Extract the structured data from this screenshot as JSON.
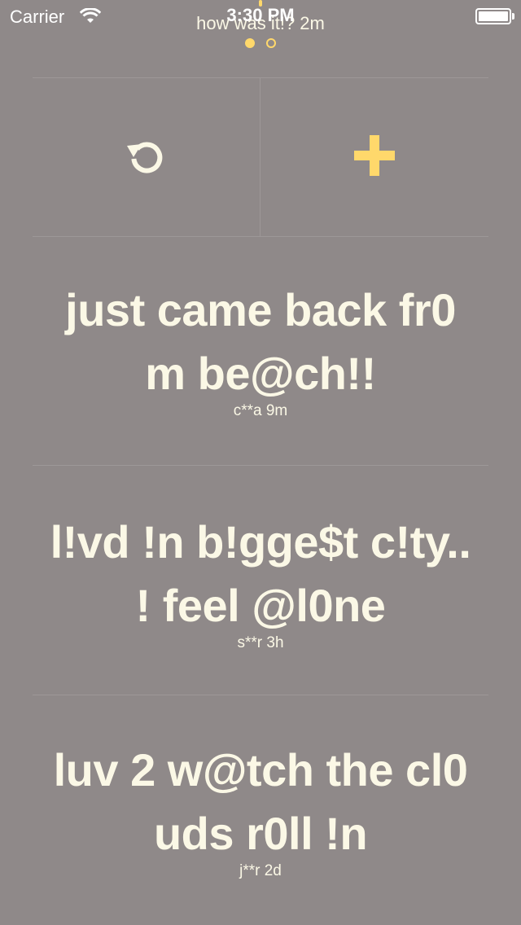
{
  "status_bar": {
    "carrier": "Carrier",
    "time": "3:30 PM"
  },
  "top_caption": "how was it!? 2m",
  "pager": {
    "pages": 2,
    "active": 0
  },
  "actions": {
    "refresh_icon": "refresh-icon",
    "add_icon": "plus-icon",
    "accent_color": "#ffd86b"
  },
  "posts": [
    {
      "text_line1": "just came back fr0",
      "text_line2": "m be@ch!!",
      "meta": "c**a  9m"
    },
    {
      "text_line1": "l!vd !n b!gge$t c!ty..",
      "text_line2": "! feel @l0ne",
      "meta": "s**r  3h"
    },
    {
      "text_line1": "luv 2 w@tch the cl0",
      "text_line2": "uds r0ll !n",
      "meta": "j**r  2d"
    }
  ]
}
